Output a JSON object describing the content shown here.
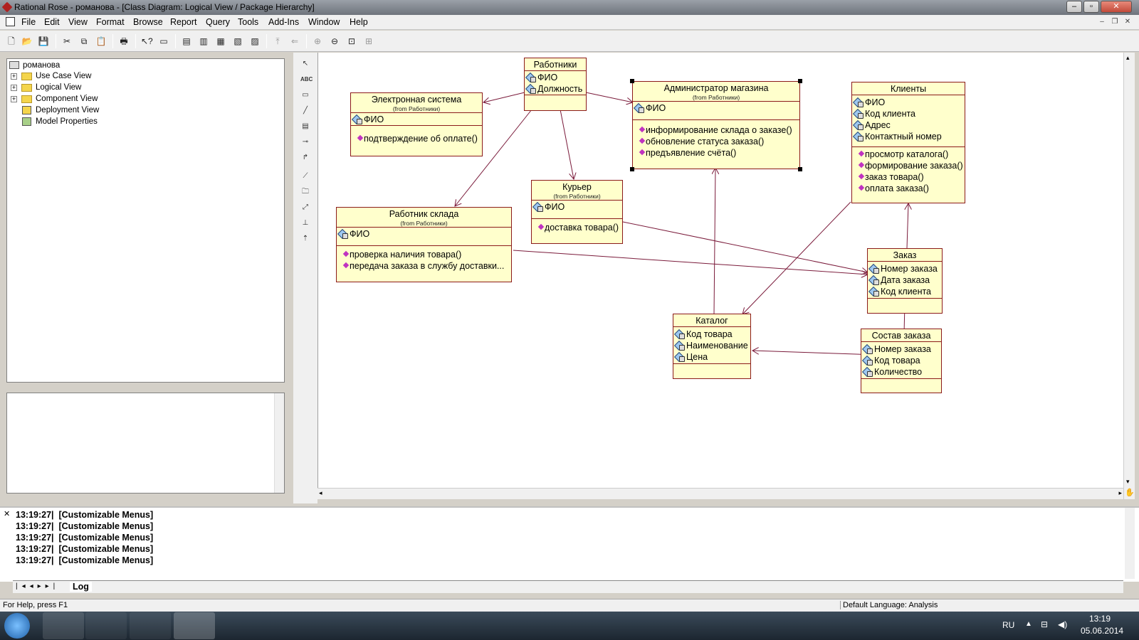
{
  "window": {
    "title": "Rational Rose - романова - [Class Diagram: Logical View / Package Hierarchy]"
  },
  "menu": [
    "File",
    "Edit",
    "View",
    "Format",
    "Browse",
    "Report",
    "Query",
    "Tools",
    "Add-Ins",
    "Window",
    "Help"
  ],
  "browser": {
    "root": "романова",
    "items": [
      {
        "label": "Use Case View"
      },
      {
        "label": "Logical View"
      },
      {
        "label": "Component View"
      },
      {
        "label": "Deployment View"
      },
      {
        "label": "Model Properties"
      }
    ]
  },
  "diagram": {
    "classes": {
      "rabotniki": {
        "name": "Работники",
        "attrs": [
          "ФИО",
          "Должность"
        ],
        "ops": []
      },
      "el_sistema": {
        "name": "Электронная система",
        "from": "(from Работники)",
        "attrs": [
          "ФИО"
        ],
        "ops": [
          "подтверждение об оплате()"
        ]
      },
      "admin": {
        "name": "Администратор магазина",
        "from": "(from Работники)",
        "attrs": [
          "ФИО"
        ],
        "ops": [
          "информирование склада о заказе()",
          "обновление статуса заказа()",
          "предъявление счёта()"
        ]
      },
      "klienty": {
        "name": "Клиенты",
        "attrs": [
          "ФИО",
          "Код клиента",
          "Адрес",
          "Контактный номер"
        ],
        "ops": [
          "просмотр каталога()",
          "формирование заказа()",
          "заказ товара()",
          "оплата заказа()"
        ]
      },
      "kurer": {
        "name": "Курьер",
        "from": "(from Работники)",
        "attrs": [
          "ФИО"
        ],
        "ops": [
          "доставка товара()"
        ]
      },
      "sklad": {
        "name": "Работник склада",
        "from": "(from Работники)",
        "attrs": [
          "ФИО"
        ],
        "ops": [
          "проверка наличия товара()",
          "передача заказа в службу доставки..."
        ]
      },
      "zakaz": {
        "name": "Заказ",
        "attrs": [
          "Номер заказа",
          "Дата заказа",
          "Код клиента"
        ],
        "ops": []
      },
      "katalog": {
        "name": "Каталог",
        "attrs": [
          "Код товара",
          "Наименование",
          "Цена"
        ],
        "ops": []
      },
      "sostav": {
        "name": "Состав заказа",
        "attrs": [
          "Номер заказа",
          "Код товара",
          "Количество"
        ],
        "ops": []
      }
    }
  },
  "log": {
    "lines": [
      "13:19:27|  [Customizable Menus]",
      "13:19:27|  [Customizable Menus]",
      "13:19:27|  [Customizable Menus]",
      "13:19:27|  [Customizable Menus]",
      "13:19:27|  [Customizable Menus]"
    ],
    "tab": "Log"
  },
  "status": {
    "help": "For Help, press F1",
    "language": "Default Language: Analysis"
  },
  "taskbar": {
    "lang": "RU",
    "time": "13:19",
    "date": "05.06.2014"
  }
}
